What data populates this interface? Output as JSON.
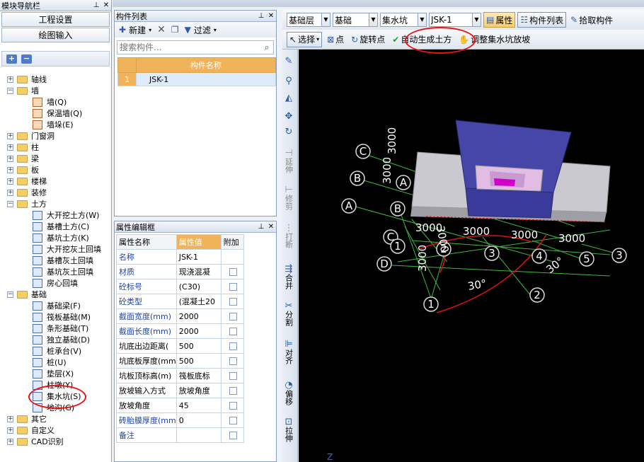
{
  "nav": {
    "title": "模块导航栏",
    "project_settings": "工程设置",
    "drawing_input": "绘图输入",
    "tree": [
      {
        "label": "轴线",
        "expand": "+",
        "kind": "folder",
        "level": 0
      },
      {
        "label": "墙",
        "expand": "-",
        "kind": "folder-open",
        "level": 0
      },
      {
        "label": "墙(Q)",
        "kind": "item-brown",
        "level": 1
      },
      {
        "label": "保温墙(Q)",
        "kind": "item-brown",
        "level": 1
      },
      {
        "label": "墙垛(E)",
        "kind": "item-brown",
        "level": 1
      },
      {
        "label": "门窗洞",
        "expand": "+",
        "kind": "folder",
        "level": 0
      },
      {
        "label": "柱",
        "expand": "+",
        "kind": "folder",
        "level": 0
      },
      {
        "label": "梁",
        "expand": "+",
        "kind": "folder",
        "level": 0
      },
      {
        "label": "板",
        "expand": "+",
        "kind": "folder",
        "level": 0
      },
      {
        "label": "楼梯",
        "expand": "+",
        "kind": "folder",
        "level": 0
      },
      {
        "label": "装修",
        "expand": "+",
        "kind": "folder",
        "level": 0
      },
      {
        "label": "土方",
        "expand": "-",
        "kind": "folder-open",
        "level": 0
      },
      {
        "label": "大开挖土方(W)",
        "kind": "item",
        "level": 1
      },
      {
        "label": "基槽土方(C)",
        "kind": "item",
        "level": 1
      },
      {
        "label": "基坑土方(K)",
        "kind": "item",
        "level": 1
      },
      {
        "label": "大开挖灰土回填",
        "kind": "item",
        "level": 1
      },
      {
        "label": "基槽灰土回填",
        "kind": "item",
        "level": 1
      },
      {
        "label": "基坑灰土回填",
        "kind": "item",
        "level": 1
      },
      {
        "label": "房心回填",
        "kind": "item",
        "level": 1
      },
      {
        "label": "基础",
        "expand": "-",
        "kind": "folder-open",
        "level": 0
      },
      {
        "label": "基础梁(F)",
        "kind": "item",
        "level": 1
      },
      {
        "label": "筏板基础(M)",
        "kind": "item",
        "level": 1
      },
      {
        "label": "条形基础(T)",
        "kind": "item",
        "level": 1
      },
      {
        "label": "独立基础(D)",
        "kind": "item",
        "level": 1
      },
      {
        "label": "桩承台(V)",
        "kind": "item",
        "level": 1
      },
      {
        "label": "桩(U)",
        "kind": "item",
        "level": 1
      },
      {
        "label": "垫层(X)",
        "kind": "item",
        "level": 1
      },
      {
        "label": "柱墩(Y)",
        "kind": "item",
        "level": 1
      },
      {
        "label": "集水坑(S)",
        "kind": "item",
        "level": 1
      },
      {
        "label": "地沟(G)",
        "kind": "item",
        "level": 1
      },
      {
        "label": "其它",
        "expand": "+",
        "kind": "folder",
        "level": 0
      },
      {
        "label": "自定义",
        "expand": "+",
        "kind": "folder",
        "level": 0
      },
      {
        "label": "CAD识别",
        "expand": "+",
        "kind": "folder",
        "level": 0
      }
    ]
  },
  "comp_list": {
    "title": "构件列表",
    "new_label": "新建",
    "filter_label": "过滤",
    "search_placeholder": "搜索构件...",
    "column_header": "构件名称",
    "rows": [
      {
        "index": "1",
        "name": "JSK-1"
      }
    ]
  },
  "prop_editor": {
    "title": "属性编辑框",
    "headers": {
      "name": "属性名称",
      "value": "属性值",
      "extra": "附加"
    },
    "rows": [
      {
        "name": "名称",
        "value": "JSK-1",
        "blue": true,
        "check": false
      },
      {
        "name": "材质",
        "value": "现浇混凝",
        "blue": true,
        "check": true
      },
      {
        "name": "砼标号",
        "value": "(C30)",
        "blue": true,
        "check": true
      },
      {
        "name": "砼类型",
        "value": "(混凝土20",
        "blue": true,
        "check": true
      },
      {
        "name": "截面宽度(mm)",
        "value": "2000",
        "blue": true,
        "check": true
      },
      {
        "name": "截面长度(mm)",
        "value": "2000",
        "blue": true,
        "check": true
      },
      {
        "name": "坑底出边距离(",
        "value": "500",
        "blue": false,
        "check": true
      },
      {
        "name": "坑底板厚度(mm",
        "value": "500",
        "blue": false,
        "check": true
      },
      {
        "name": "坑板顶标高(m)",
        "value": "筏板底标",
        "blue": false,
        "check": true
      },
      {
        "name": "放坡输入方式",
        "value": "放坡角度",
        "blue": false,
        "check": true
      },
      {
        "name": "放坡角度",
        "value": "45",
        "blue": false,
        "check": true
      },
      {
        "name": "砖胎膜厚度(mm",
        "value": "0",
        "blue": true,
        "check": true
      },
      {
        "name": "备注",
        "value": "",
        "blue": true,
        "check": true
      }
    ]
  },
  "toolbar1": {
    "floor": "基础层",
    "category": "基础",
    "type": "集水坑",
    "component": "JSK-1",
    "properties": "属性",
    "component_list": "构件列表",
    "pick_component": "拾取构件"
  },
  "toolbar2": {
    "select": "选择",
    "point": "点",
    "rotate_point": "旋转点",
    "auto_earthwork": "自动生成土方",
    "adjust_slope": "调整集水坑放坡"
  },
  "vstrip": {
    "extend": "延伸",
    "trim": "修剪",
    "break": "打断",
    "merge": "合并",
    "split": "分割",
    "align": "对齐",
    "offset": "偏移",
    "stretch": "拉伸"
  },
  "view3d": {
    "axis_letters": [
      "C",
      "B",
      "A",
      "A",
      "B",
      "C",
      "D"
    ],
    "axis_numbers": [
      "1",
      "2",
      "3",
      "4",
      "5",
      "3",
      "2",
      "1"
    ],
    "dimensions": [
      "3000",
      "3000",
      "3000",
      "3000",
      "3000",
      "3000",
      "3000",
      "3000"
    ],
    "angle_labels": [
      "30°",
      "30°"
    ],
    "z_label": "Z"
  },
  "colors": {
    "pit_blue": "#3a3a9a",
    "slab_gray": "#c9c9cf",
    "grid_green": "#3fb83f",
    "arc_red": "#d11",
    "magenta": "#d400c8"
  }
}
